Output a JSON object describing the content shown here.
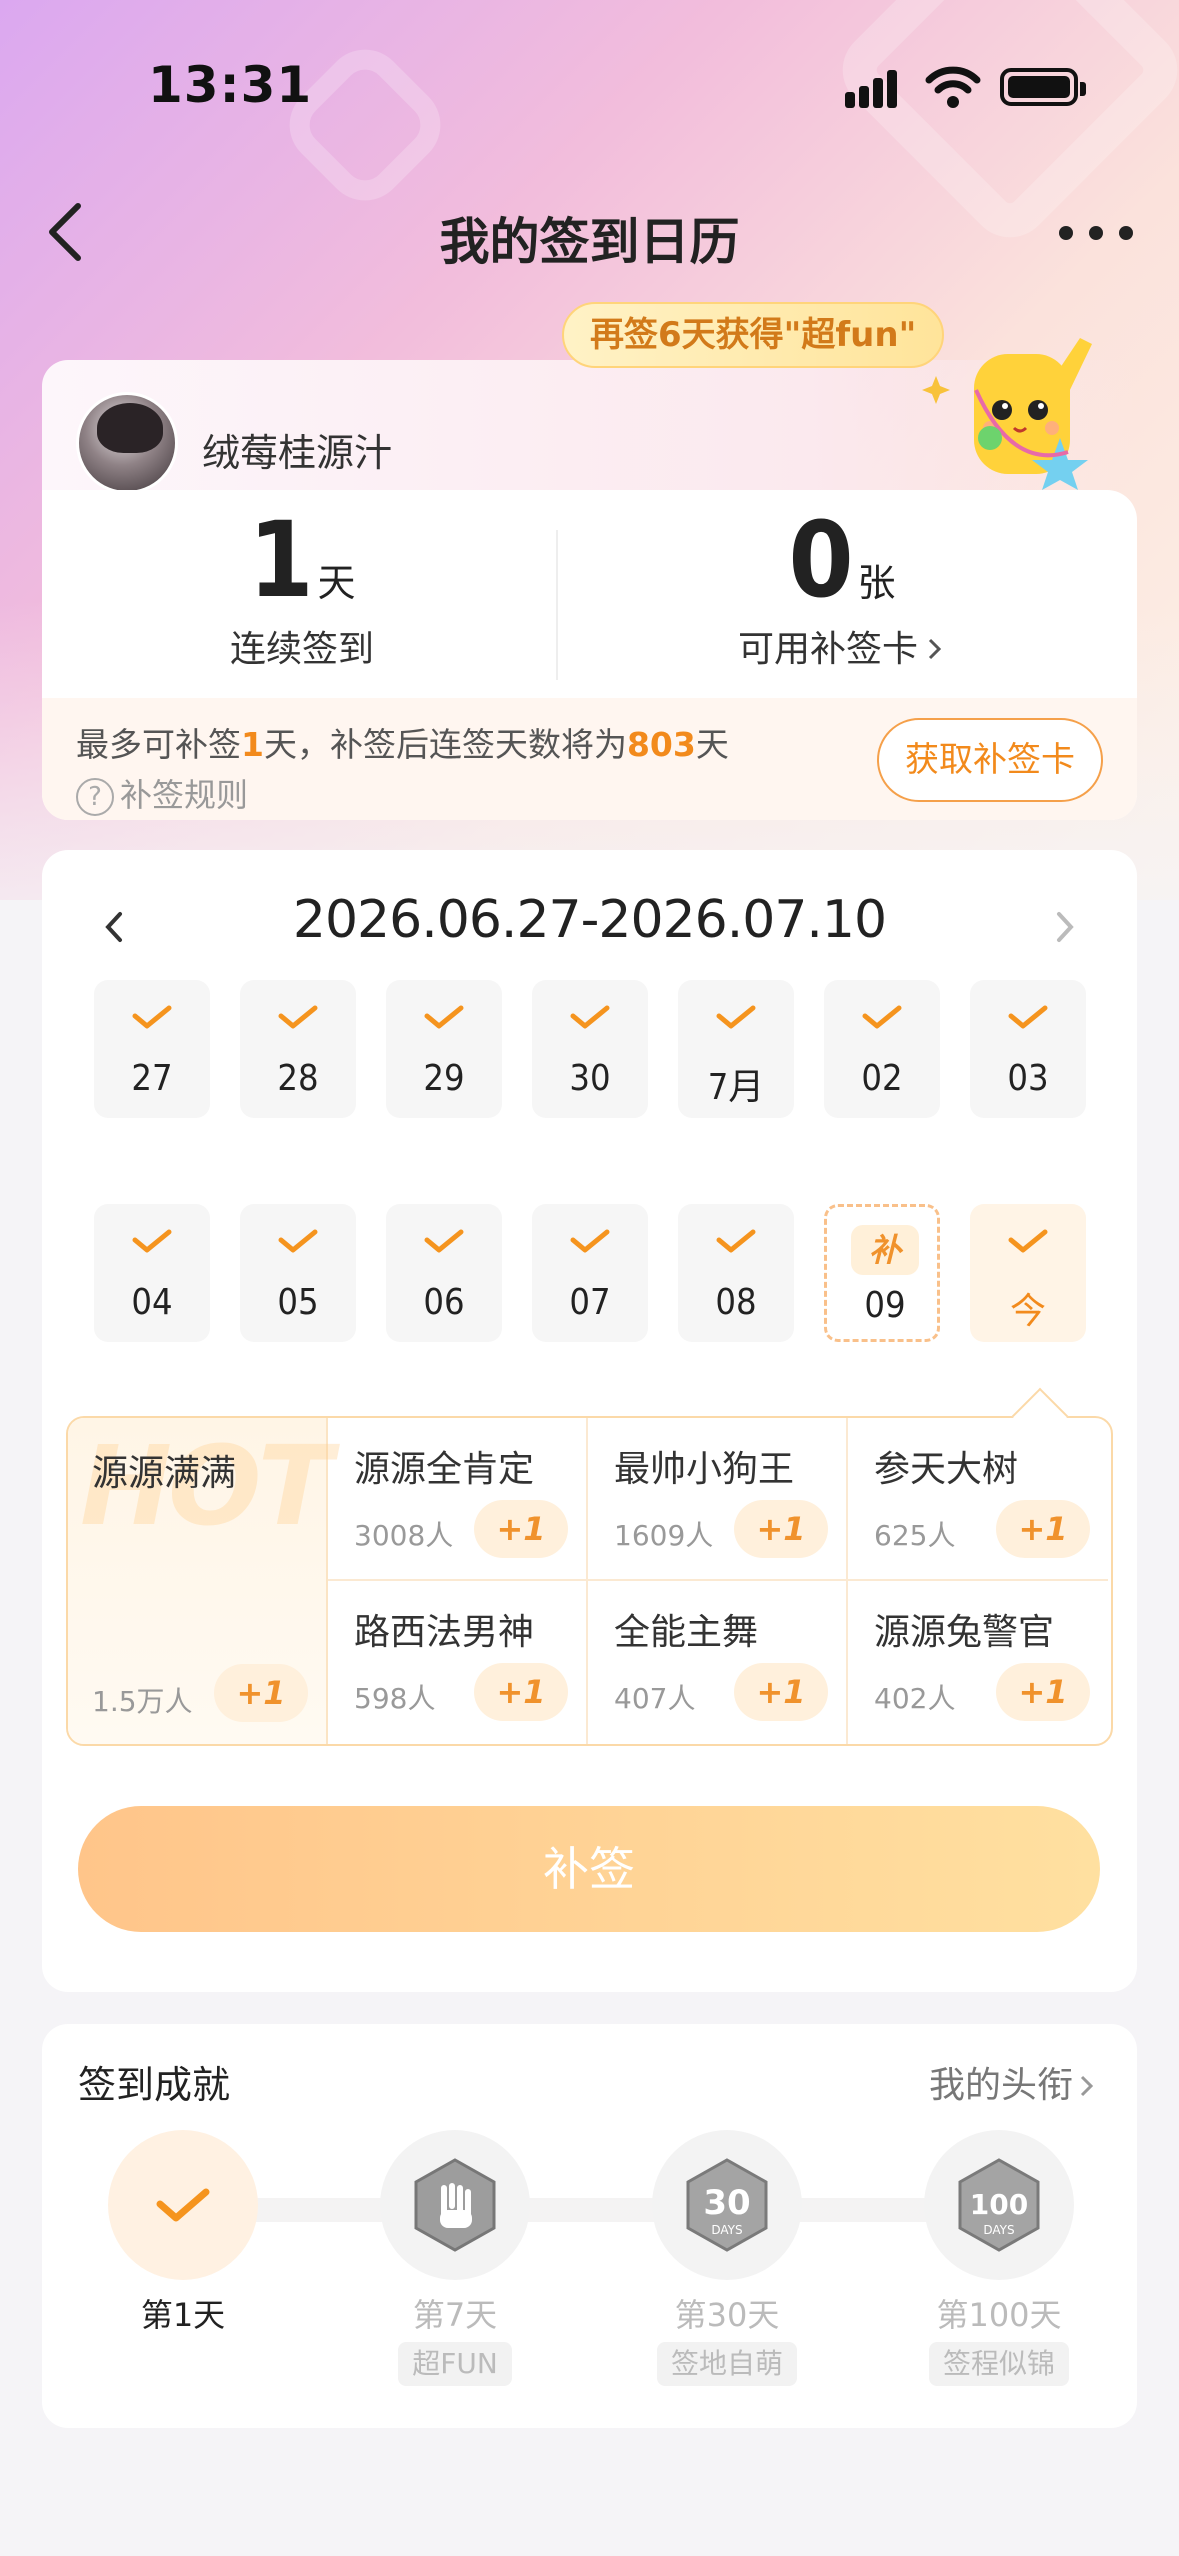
{
  "status": {
    "time": "13:31"
  },
  "nav": {
    "title": "我的签到日历"
  },
  "profile": {
    "username": "绒莓桂源汁",
    "promo": "再签6天获得\"超fun\"",
    "streak": {
      "value": "1",
      "unit": "天",
      "label": "连续签到"
    },
    "cards": {
      "value": "0",
      "unit": "张",
      "label": "可用补签卡"
    },
    "makeup_prefix": "最多可补签",
    "makeup_days": "1",
    "makeup_mid": "天，补签后连签天数将为",
    "makeup_total": "803",
    "makeup_suffix": "天",
    "rules": "补签规则",
    "get_card": "获取补签卡"
  },
  "calendar": {
    "range": "2026.06.27-2026.07.10",
    "week1": [
      "27",
      "28",
      "29",
      "30",
      "7月",
      "02",
      "03"
    ],
    "week2": [
      "04",
      "05",
      "06",
      "07",
      "08"
    ],
    "makeup_day": {
      "badge": "补",
      "num": "09"
    },
    "today": "今",
    "accent": "#f28a1c"
  },
  "titles": {
    "hot": {
      "watermark": "HOT",
      "name": "源源满满",
      "count": "1.5万人",
      "plus": "+1"
    },
    "items": [
      {
        "name": "源源全肯定",
        "count": "3008人",
        "plus": "+1"
      },
      {
        "name": "最帅小狗王",
        "count": "1609人",
        "plus": "+1"
      },
      {
        "name": "参天大树",
        "count": "625人",
        "plus": "+1"
      },
      {
        "name": "路西法男神",
        "count": "598人",
        "plus": "+1"
      },
      {
        "name": "全能主舞",
        "count": "407人",
        "plus": "+1"
      },
      {
        "name": "源源兔警官",
        "count": "402人",
        "plus": "+1"
      }
    ],
    "makeup_button": "补签"
  },
  "achievements": {
    "title": "签到成就",
    "link": "我的头衔",
    "items": [
      {
        "day": "第1天",
        "tag": ""
      },
      {
        "day": "第7天",
        "tag": "超FUN"
      },
      {
        "day": "第30天",
        "tag": "签地自萌"
      },
      {
        "day": "第100天",
        "tag": "签程似锦"
      }
    ]
  }
}
